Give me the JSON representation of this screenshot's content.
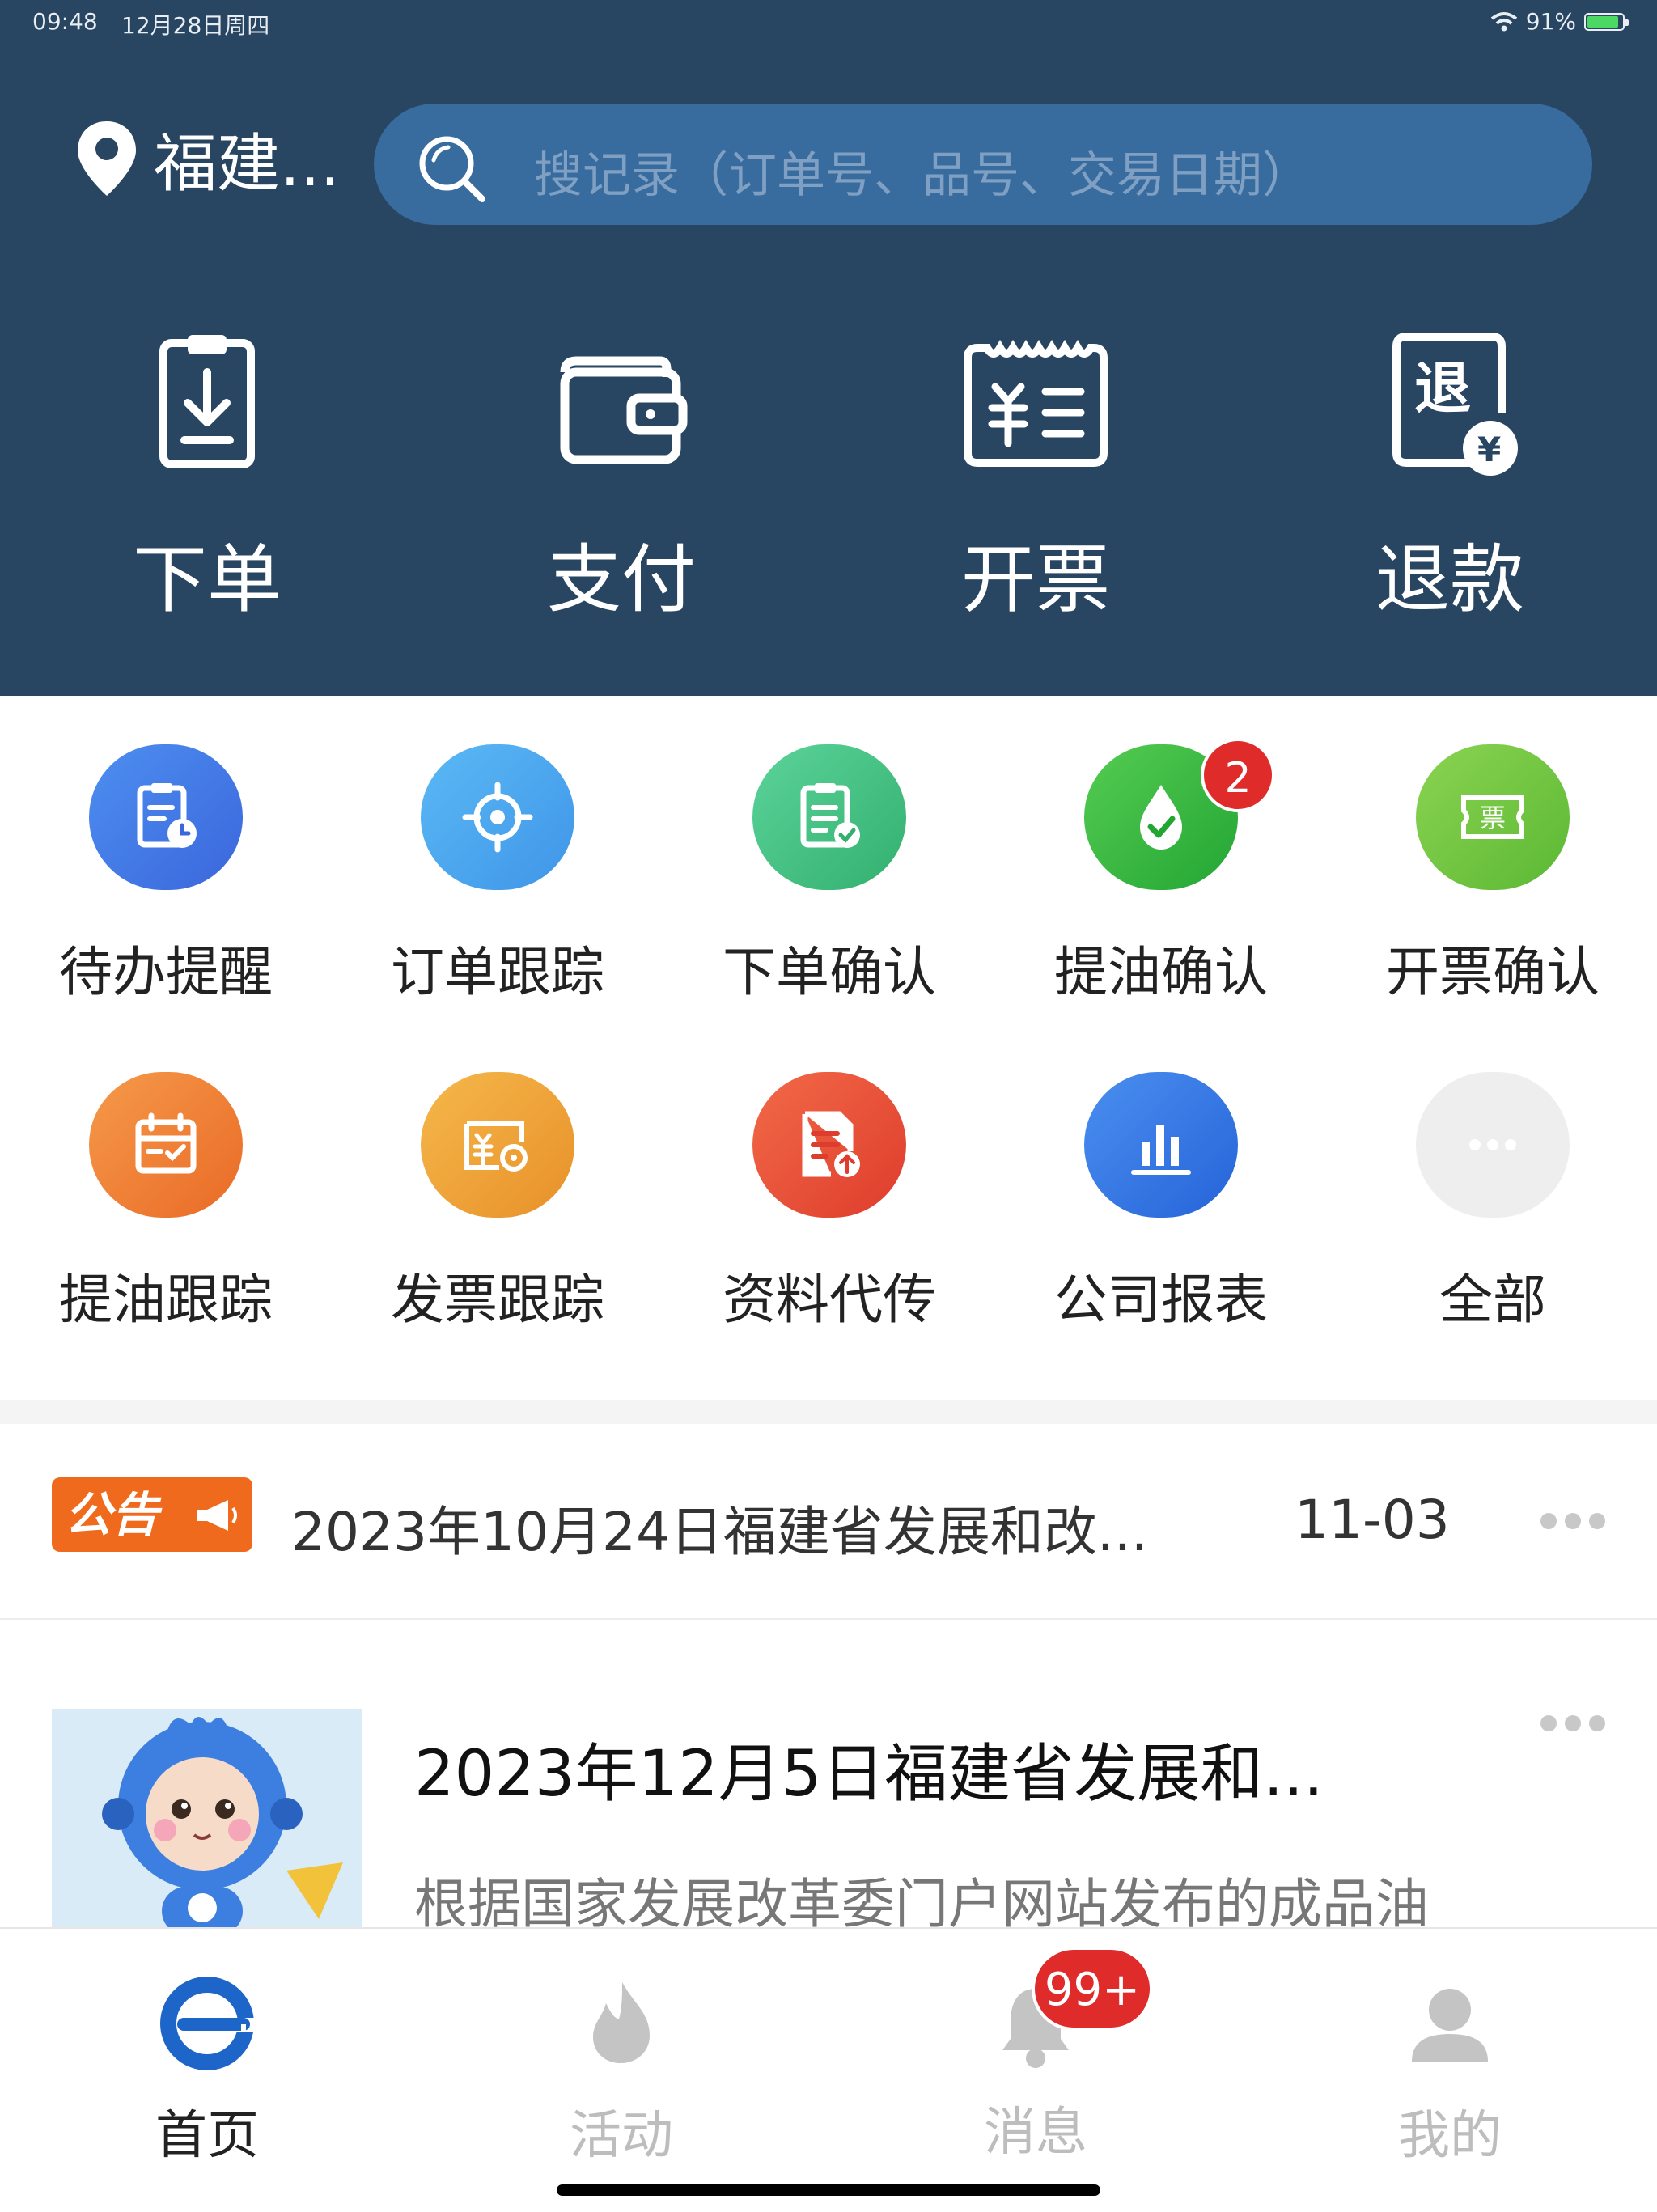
{
  "status_bar": {
    "time": "09:48",
    "date": "12月28日周四",
    "battery": "91%",
    "battery_level": 0.91
  },
  "header": {
    "location": "福建...",
    "search_placeholder": "搜记录（订单号、品号、交易日期）",
    "actions": [
      {
        "label": "下单",
        "icon": "order-download-icon"
      },
      {
        "label": "支付",
        "icon": "wallet-icon"
      },
      {
        "label": "开票",
        "icon": "invoice-icon"
      },
      {
        "label": "退款",
        "icon": "refund-icon"
      }
    ]
  },
  "grid": [
    {
      "label": "待办提醒",
      "icon": "todo-clipboard-icon",
      "color": "#3d7fe6"
    },
    {
      "label": "订单跟踪",
      "icon": "target-icon",
      "color": "#49a7ef"
    },
    {
      "label": "下单确认",
      "icon": "clipboard-check-icon",
      "color": "#3fbe7e"
    },
    {
      "label": "提油确认",
      "icon": "oil-drop-icon",
      "color": "#2fb344",
      "badge": "2"
    },
    {
      "label": "开票确认",
      "icon": "ticket-icon",
      "color": "#6cc23a"
    },
    {
      "label": "提油跟踪",
      "icon": "calendar-check-icon",
      "color": "#f07a2d"
    },
    {
      "label": "发票跟踪",
      "icon": "invoice-track-icon",
      "color": "#f0a02d"
    },
    {
      "label": "资料代传",
      "icon": "document-upload-icon",
      "color": "#e8513a"
    },
    {
      "label": "公司报表",
      "icon": "bar-chart-icon",
      "color": "#2f75e0"
    },
    {
      "label": "全部",
      "icon": "more-icon",
      "color": "#eeeeee"
    }
  ],
  "notice": {
    "tag": "公告",
    "text": "2023年10月24日福建省发展和改...",
    "date": "11-03"
  },
  "article": {
    "title": "2023年12月5日福建省发展和...",
    "summary": "根据国家发展改革委门户网站发布的成品油"
  },
  "tabbar": {
    "items": [
      {
        "label": "首页",
        "icon": "home-e-icon",
        "active": true
      },
      {
        "label": "活动",
        "icon": "flame-icon",
        "active": false
      },
      {
        "label": "消息",
        "icon": "bell-icon",
        "active": false,
        "badge": "99+"
      },
      {
        "label": "我的",
        "icon": "person-icon",
        "active": false
      }
    ]
  },
  "colors": {
    "header_bg": "#284561",
    "search_bg": "#386b9e",
    "active_tab": "#1d65c8",
    "inactive_tab": "#bdbdbd",
    "badge": "#e02b2b"
  }
}
